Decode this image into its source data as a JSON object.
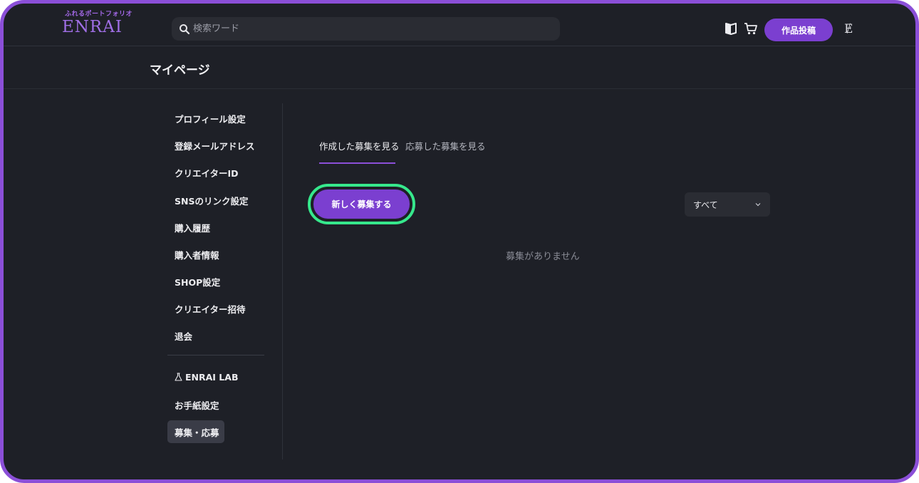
{
  "header": {
    "logo_sub": "ふれるポートフォリオ",
    "logo_main": "ENRAI",
    "search_placeholder": "検索ワード",
    "post_button": "作品投稿",
    "menu_glyph": "Ɇ"
  },
  "page_title": "マイページ",
  "sidebar": {
    "items": [
      "プロフィール設定",
      "登録メールアドレス",
      "クリエイターID",
      "SNSのリンク設定",
      "購入履歴",
      "購入者情報",
      "SHOP設定",
      "クリエイター招待",
      "退会"
    ],
    "lab_item": "ENRAI LAB",
    "extra_items": [
      "お手紙設定",
      "募集・応募"
    ],
    "active_item": "募集・応募"
  },
  "tabs": {
    "created": "作成した募集を見る",
    "applied": "応募した募集を見る"
  },
  "new_button": "新しく募集する",
  "filter": {
    "selected": "すべて"
  },
  "empty_message": "募集がありません",
  "colors": {
    "accent": "#7b3fd0",
    "highlight_ring": "#36e88c",
    "background": "#1e2027"
  }
}
